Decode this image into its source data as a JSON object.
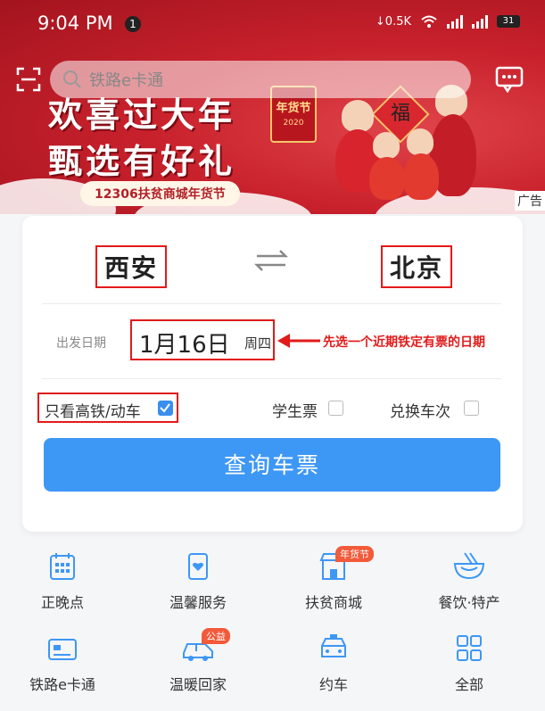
{
  "status_bar": {
    "time": "9:04 PM",
    "notification_count": "1",
    "net_speed": "0.5K",
    "battery": "31"
  },
  "search": {
    "placeholder": "铁路e卡通"
  },
  "banner": {
    "headline_1": "欢喜过大年",
    "headline_2": "甄选有好礼",
    "subline": "12306扶贫商城年货节",
    "festival_tag": "年货节",
    "festival_year": "2020",
    "fu_char": "福",
    "ad_label": "广告"
  },
  "booking": {
    "from_city": "西安",
    "to_city": "北京",
    "date_label": "出发日期",
    "date": "1月16日",
    "weekday": "周四",
    "annotation": "先选一个近期铁定有票的日期",
    "option_high_speed": "只看高铁/动车",
    "option_student": "学生票",
    "option_swap": "兑换车次",
    "high_speed_checked": true,
    "student_checked": false,
    "swap_checked": false,
    "query_button": "查询车票"
  },
  "services": [
    {
      "label": "正晚点",
      "icon": "calendar-icon"
    },
    {
      "label": "温馨服务",
      "icon": "service-icon",
      "badge": ""
    },
    {
      "label": "扶贫商城",
      "icon": "shop-icon",
      "badge": "年货节"
    },
    {
      "label": "餐饮·特产",
      "icon": "bowl-icon"
    },
    {
      "label": "铁路e卡通",
      "icon": "card-icon"
    },
    {
      "label": "温暖回家",
      "icon": "car-icon",
      "badge": "公益"
    },
    {
      "label": "约车",
      "icon": "taxi-icon"
    },
    {
      "label": "全部",
      "icon": "grid-icon"
    }
  ],
  "colors": {
    "accent": "#3d97f5",
    "highlight": "#e21a1a",
    "banner_red": "#c8212c"
  }
}
